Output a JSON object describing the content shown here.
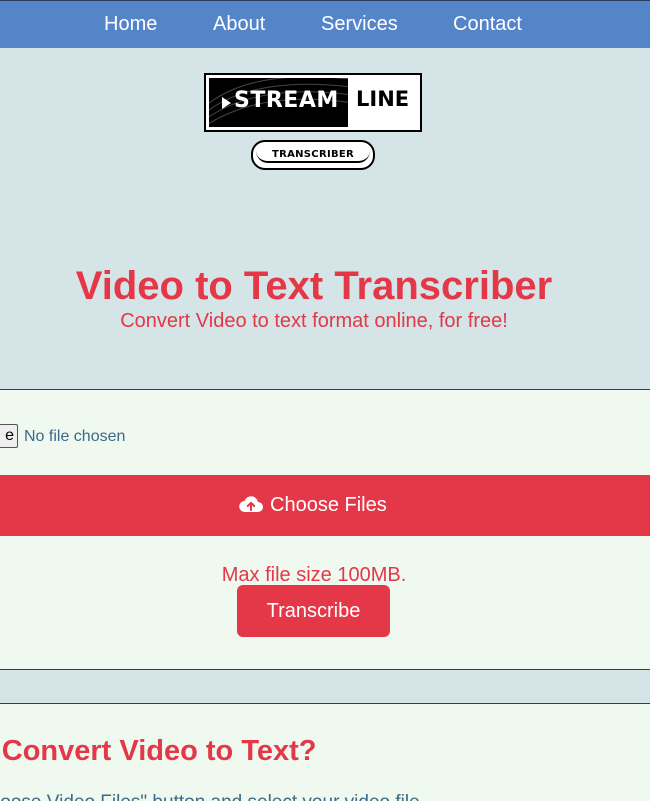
{
  "nav": {
    "items": [
      {
        "label": "Home"
      },
      {
        "label": "About"
      },
      {
        "label": "Services"
      },
      {
        "label": "Contact"
      }
    ]
  },
  "logo": {
    "word1": "STREAM",
    "word2": "LINE",
    "tagline": "TRANSCRIBER"
  },
  "hero": {
    "title": "Video to Text Transcriber",
    "subtitle": "Convert Video to text format online, for free!"
  },
  "upload": {
    "file_button_label": "e",
    "file_status": "No file chosen",
    "choose_label": "Choose Files",
    "max_size": "Max file size 100MB.",
    "transcribe_label": "Transcribe"
  },
  "howto": {
    "title": "o Convert Video to Text?",
    "step_text": "Choose Video Files\" button and select your video file"
  },
  "colors": {
    "nav_bg": "#5585c9",
    "accent_red": "#e43747",
    "hero_bg": "#d5e4e6",
    "section_bg": "#f0f9ef",
    "link_blue": "#3c6a86"
  }
}
